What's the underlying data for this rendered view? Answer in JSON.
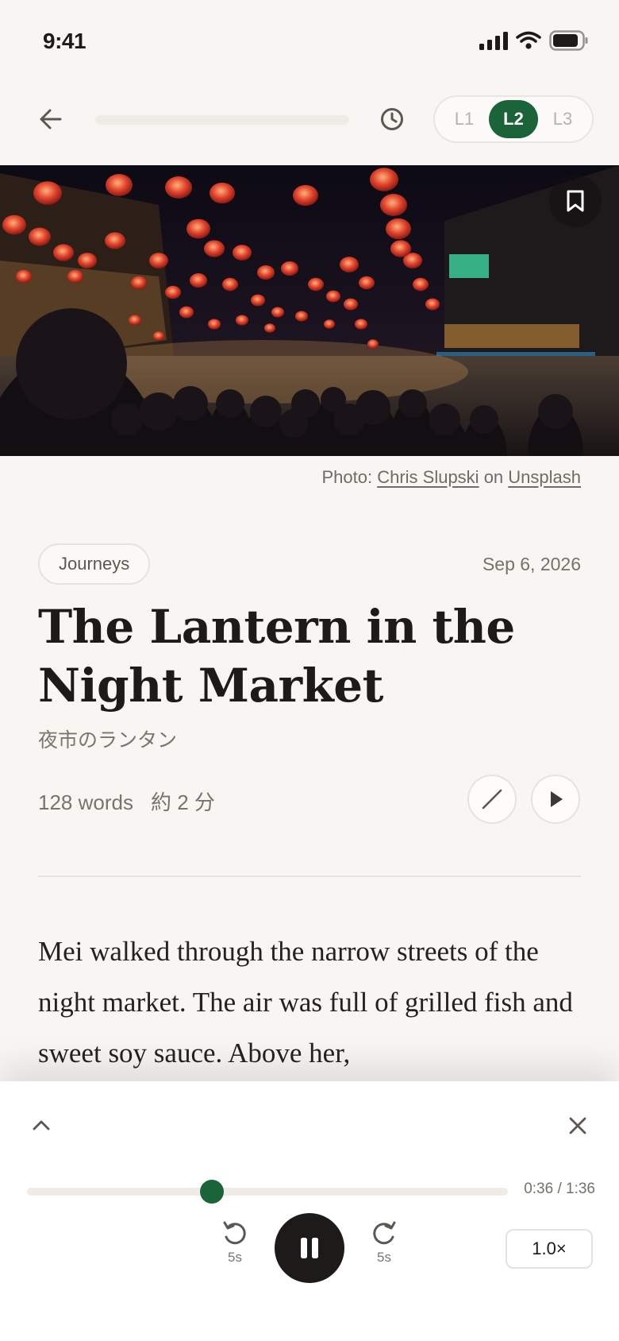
{
  "status_bar": {
    "time": "9:41"
  },
  "top_bar": {
    "levels": [
      {
        "label": "L1",
        "active": false
      },
      {
        "label": "L2",
        "active": true
      },
      {
        "label": "L3",
        "active": false
      }
    ]
  },
  "hero": {
    "photo_credit_prefix": "Photo: ",
    "photographer": "Chris Slupski",
    "on_word": " on ",
    "source": "Unsplash"
  },
  "article": {
    "category": "Journeys",
    "date": "Sep 6, 2026",
    "title": "The Lantern in the Night Market",
    "subtitle_jp": "夜市のランタン",
    "word_count": "128 words",
    "read_time_jp": "約 2 分",
    "body": "Mei walked through the narrow streets of the night market. The air was full of grilled fish and sweet soy sauce. Above her,"
  },
  "player": {
    "progress": 0.385,
    "time_readout": "0:36 / 1:36",
    "skip_back_label": "5s",
    "skip_forward_label": "5s",
    "speed": "1.0×"
  },
  "colors": {
    "accent": "#1b6339",
    "background": "#f8f6f3",
    "text": "#1c1b19"
  }
}
